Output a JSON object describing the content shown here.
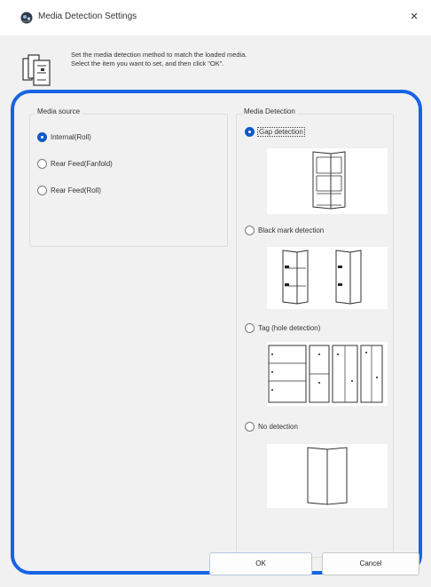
{
  "window": {
    "title": "Media Detection Settings",
    "close_glyph": "×"
  },
  "info": {
    "icon": "printer-media-icon",
    "line1": "Set the media detection method to match the loaded media.",
    "line2": "Select the item you want to set, and then click \"OK\"."
  },
  "media_source": {
    "label": "Media source",
    "selected": "Internal(Roll)",
    "options": [
      {
        "label": "Internal(Roll)",
        "checked": true
      },
      {
        "label": "Rear Feed(Fanfold)",
        "checked": false
      },
      {
        "label": "Rear Feed(Roll)",
        "checked": false
      }
    ]
  },
  "media_detection": {
    "label": "Media Detection",
    "selected": "Gap detection",
    "options": [
      {
        "label": "Gap detection",
        "checked": true,
        "illustration": "gap-detection-illustration"
      },
      {
        "label": "Black mark detection",
        "checked": false,
        "illustration": "black-mark-illustration"
      },
      {
        "label": "Tag (hole detection)",
        "checked": false,
        "illustration": "tag-hole-illustration"
      },
      {
        "label": "No detection",
        "checked": false,
        "illustration": "no-detection-illustration"
      }
    ]
  },
  "buttons": {
    "ok": "OK",
    "cancel": "Cancel"
  },
  "colors": {
    "highlight": "#1763e6",
    "radio_checked": "#0d5ac8",
    "dialog_bg": "#f1f1f1"
  }
}
